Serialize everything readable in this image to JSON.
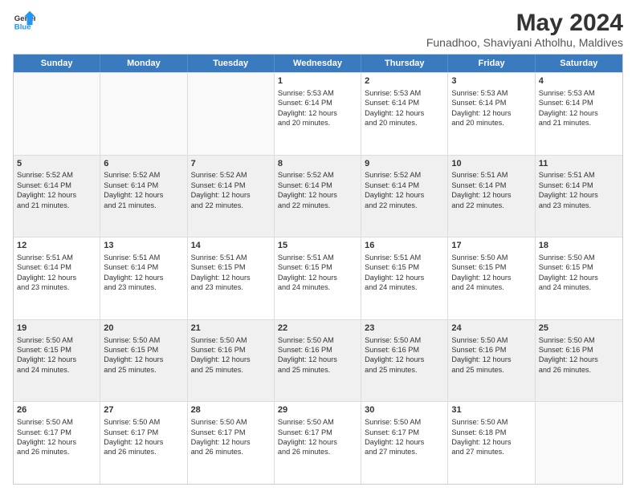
{
  "logo": {
    "line1": "General",
    "line2": "Blue"
  },
  "title": "May 2024",
  "subtitle": "Funadhoo, Shaviyani Atholhu, Maldives",
  "header_days": [
    "Sunday",
    "Monday",
    "Tuesday",
    "Wednesday",
    "Thursday",
    "Friday",
    "Saturday"
  ],
  "weeks": [
    [
      {
        "day": "",
        "info": ""
      },
      {
        "day": "",
        "info": ""
      },
      {
        "day": "",
        "info": ""
      },
      {
        "day": "1",
        "info": "Sunrise: 5:53 AM\nSunset: 6:14 PM\nDaylight: 12 hours\nand 20 minutes."
      },
      {
        "day": "2",
        "info": "Sunrise: 5:53 AM\nSunset: 6:14 PM\nDaylight: 12 hours\nand 20 minutes."
      },
      {
        "day": "3",
        "info": "Sunrise: 5:53 AM\nSunset: 6:14 PM\nDaylight: 12 hours\nand 20 minutes."
      },
      {
        "day": "4",
        "info": "Sunrise: 5:53 AM\nSunset: 6:14 PM\nDaylight: 12 hours\nand 21 minutes."
      }
    ],
    [
      {
        "day": "5",
        "info": "Sunrise: 5:52 AM\nSunset: 6:14 PM\nDaylight: 12 hours\nand 21 minutes."
      },
      {
        "day": "6",
        "info": "Sunrise: 5:52 AM\nSunset: 6:14 PM\nDaylight: 12 hours\nand 21 minutes."
      },
      {
        "day": "7",
        "info": "Sunrise: 5:52 AM\nSunset: 6:14 PM\nDaylight: 12 hours\nand 22 minutes."
      },
      {
        "day": "8",
        "info": "Sunrise: 5:52 AM\nSunset: 6:14 PM\nDaylight: 12 hours\nand 22 minutes."
      },
      {
        "day": "9",
        "info": "Sunrise: 5:52 AM\nSunset: 6:14 PM\nDaylight: 12 hours\nand 22 minutes."
      },
      {
        "day": "10",
        "info": "Sunrise: 5:51 AM\nSunset: 6:14 PM\nDaylight: 12 hours\nand 22 minutes."
      },
      {
        "day": "11",
        "info": "Sunrise: 5:51 AM\nSunset: 6:14 PM\nDaylight: 12 hours\nand 23 minutes."
      }
    ],
    [
      {
        "day": "12",
        "info": "Sunrise: 5:51 AM\nSunset: 6:14 PM\nDaylight: 12 hours\nand 23 minutes."
      },
      {
        "day": "13",
        "info": "Sunrise: 5:51 AM\nSunset: 6:14 PM\nDaylight: 12 hours\nand 23 minutes."
      },
      {
        "day": "14",
        "info": "Sunrise: 5:51 AM\nSunset: 6:15 PM\nDaylight: 12 hours\nand 23 minutes."
      },
      {
        "day": "15",
        "info": "Sunrise: 5:51 AM\nSunset: 6:15 PM\nDaylight: 12 hours\nand 24 minutes."
      },
      {
        "day": "16",
        "info": "Sunrise: 5:51 AM\nSunset: 6:15 PM\nDaylight: 12 hours\nand 24 minutes."
      },
      {
        "day": "17",
        "info": "Sunrise: 5:50 AM\nSunset: 6:15 PM\nDaylight: 12 hours\nand 24 minutes."
      },
      {
        "day": "18",
        "info": "Sunrise: 5:50 AM\nSunset: 6:15 PM\nDaylight: 12 hours\nand 24 minutes."
      }
    ],
    [
      {
        "day": "19",
        "info": "Sunrise: 5:50 AM\nSunset: 6:15 PM\nDaylight: 12 hours\nand 24 minutes."
      },
      {
        "day": "20",
        "info": "Sunrise: 5:50 AM\nSunset: 6:15 PM\nDaylight: 12 hours\nand 25 minutes."
      },
      {
        "day": "21",
        "info": "Sunrise: 5:50 AM\nSunset: 6:16 PM\nDaylight: 12 hours\nand 25 minutes."
      },
      {
        "day": "22",
        "info": "Sunrise: 5:50 AM\nSunset: 6:16 PM\nDaylight: 12 hours\nand 25 minutes."
      },
      {
        "day": "23",
        "info": "Sunrise: 5:50 AM\nSunset: 6:16 PM\nDaylight: 12 hours\nand 25 minutes."
      },
      {
        "day": "24",
        "info": "Sunrise: 5:50 AM\nSunset: 6:16 PM\nDaylight: 12 hours\nand 25 minutes."
      },
      {
        "day": "25",
        "info": "Sunrise: 5:50 AM\nSunset: 6:16 PM\nDaylight: 12 hours\nand 26 minutes."
      }
    ],
    [
      {
        "day": "26",
        "info": "Sunrise: 5:50 AM\nSunset: 6:17 PM\nDaylight: 12 hours\nand 26 minutes."
      },
      {
        "day": "27",
        "info": "Sunrise: 5:50 AM\nSunset: 6:17 PM\nDaylight: 12 hours\nand 26 minutes."
      },
      {
        "day": "28",
        "info": "Sunrise: 5:50 AM\nSunset: 6:17 PM\nDaylight: 12 hours\nand 26 minutes."
      },
      {
        "day": "29",
        "info": "Sunrise: 5:50 AM\nSunset: 6:17 PM\nDaylight: 12 hours\nand 26 minutes."
      },
      {
        "day": "30",
        "info": "Sunrise: 5:50 AM\nSunset: 6:17 PM\nDaylight: 12 hours\nand 27 minutes."
      },
      {
        "day": "31",
        "info": "Sunrise: 5:50 AM\nSunset: 6:18 PM\nDaylight: 12 hours\nand 27 minutes."
      },
      {
        "day": "",
        "info": ""
      }
    ]
  ]
}
